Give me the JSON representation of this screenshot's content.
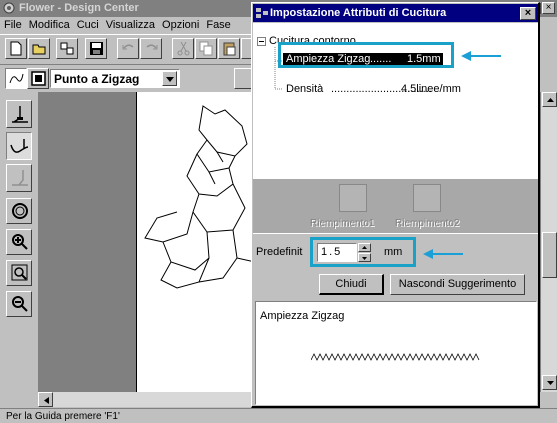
{
  "app": {
    "title": "Flower - Design Center",
    "menu": [
      "File",
      "Modifica",
      "Cuci",
      "Visualizza",
      "Opzioni",
      "Fase"
    ],
    "stitch_select": "Punto a Zigzag",
    "status_text": "Per la Guida premere 'F1'"
  },
  "dialog": {
    "title": "Impostazione Attributi di Cucitura",
    "tree_root": "Cucitura contorno",
    "tree_items": [
      {
        "label": "Ampiezza Zigzag",
        "value": "1.5mm"
      },
      {
        "label": "Densità",
        "value": "4.5linee/mm"
      }
    ],
    "fill_buttons": [
      "Riempimento1",
      "Riempimento2"
    ],
    "preset_label": "Predefinit",
    "preset_value": "1.5",
    "unit": "mm",
    "close_label": "Chiudi",
    "hide_hint_label": "Nascondi Suggerimento",
    "hint_title": "Ampiezza Zigzag",
    "close_x": "×"
  },
  "colors": {
    "titlebar": "#000080",
    "highlight": "#1aa1c8",
    "arrow": "#1a9fd6"
  }
}
